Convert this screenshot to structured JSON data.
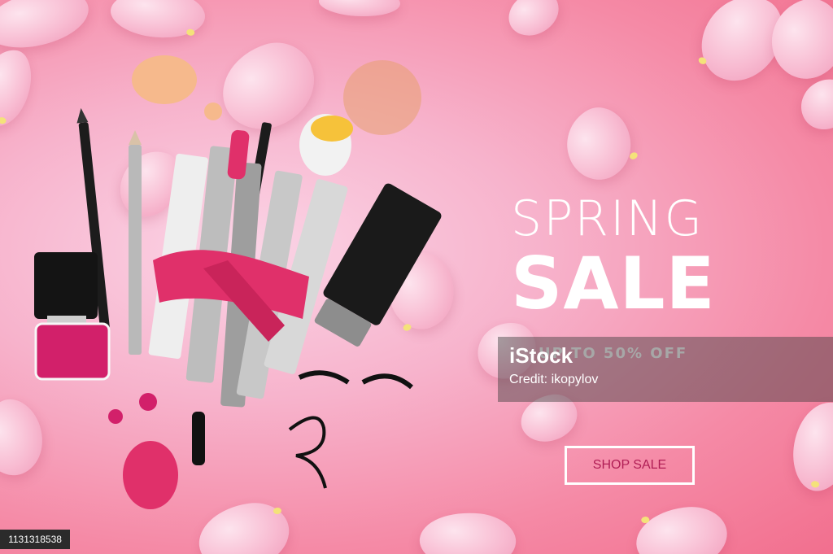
{
  "banner": {
    "title_line1": "SPRING",
    "title_line2": "SALE",
    "offer": "UP TO 50% OFF",
    "cta_label": "SHOP SALE"
  },
  "watermark": {
    "logo": "iStock",
    "credit": "Credit: ikopylov"
  },
  "stock_id": "1131318538",
  "colors": {
    "background": "#f58aa6",
    "cta_text": "#b01e55",
    "ribbon": "#e0306a"
  }
}
